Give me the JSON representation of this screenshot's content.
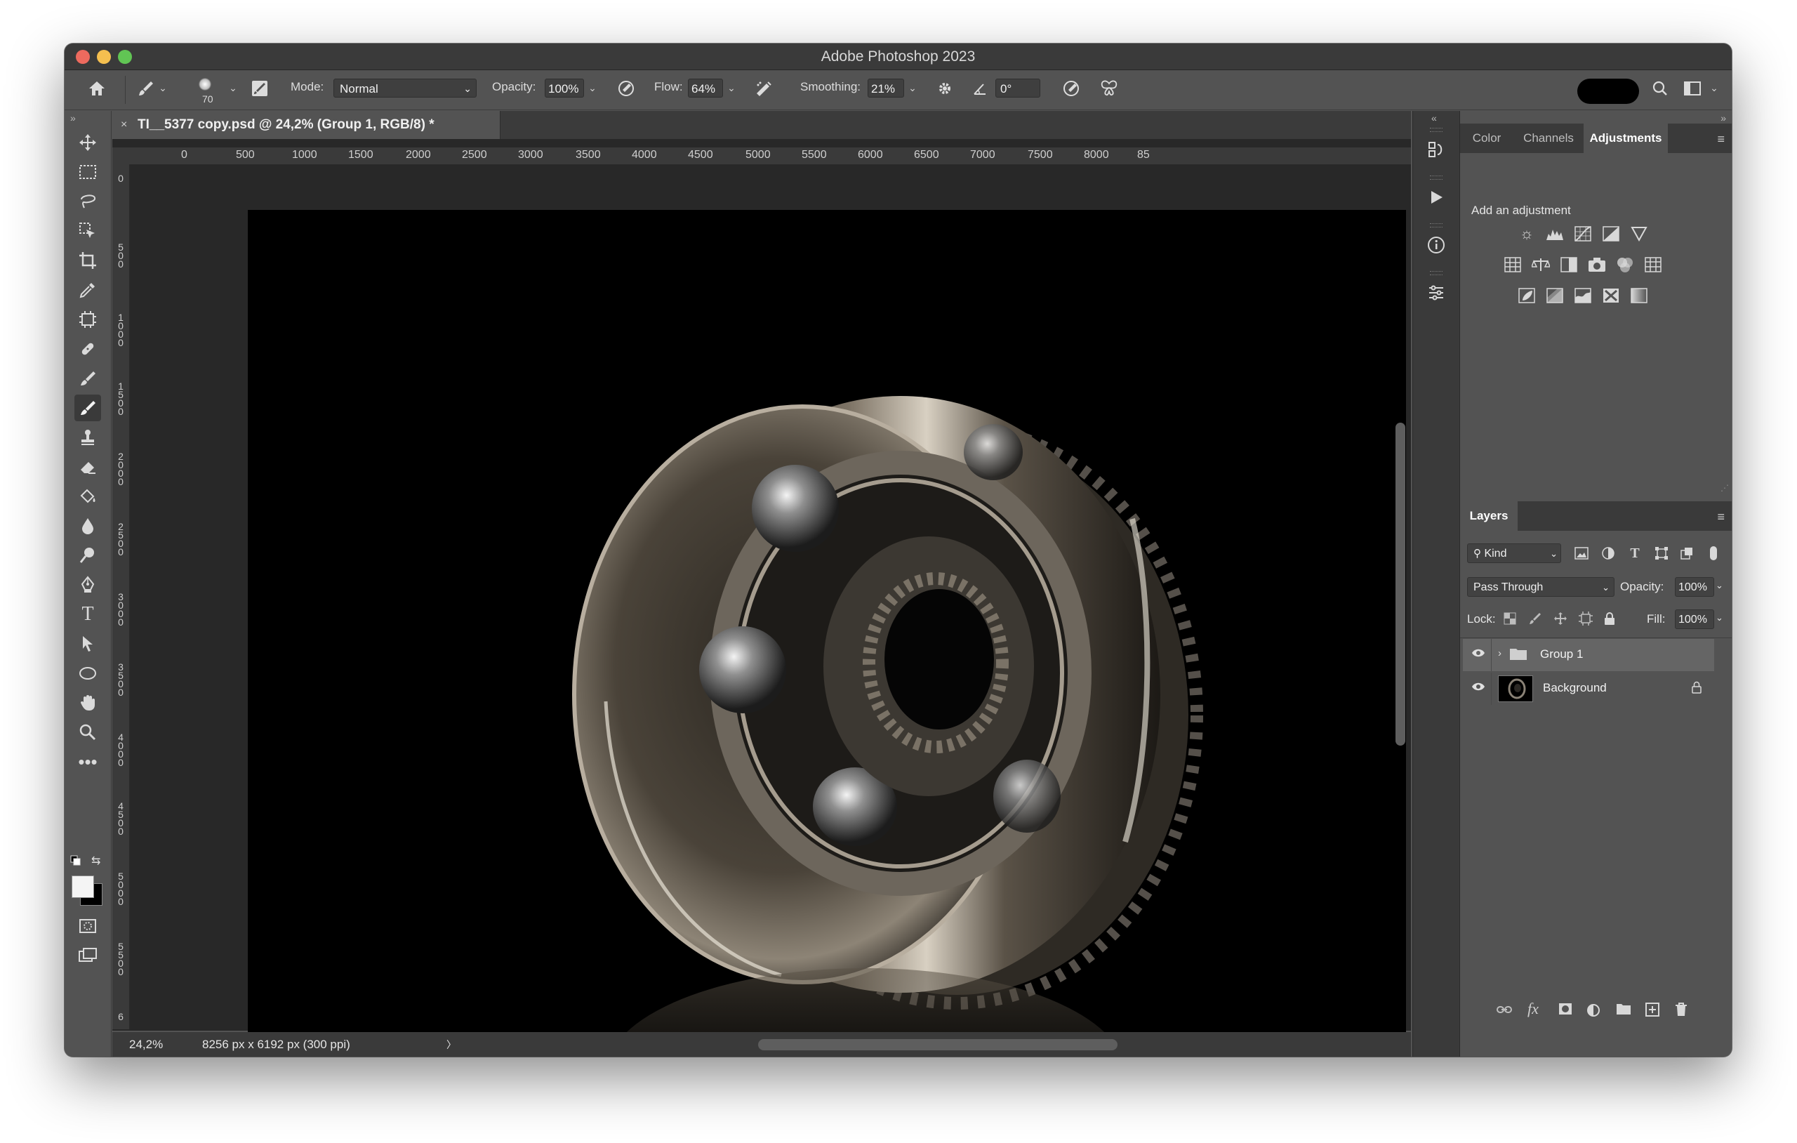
{
  "window": {
    "title": "Adobe Photoshop 2023"
  },
  "options_bar": {
    "brush_size": "70",
    "mode_label": "Mode:",
    "mode_value": "Normal",
    "opacity_label": "Opacity:",
    "opacity_value": "100%",
    "flow_label": "Flow:",
    "flow_value": "64%",
    "smoothing_label": "Smoothing:",
    "smoothing_value": "21%",
    "angle_value": "0°"
  },
  "document": {
    "tab_title": "TI__5377 copy.psd @ 24,2% (Group 1, RGB/8) *",
    "close": "×"
  },
  "ruler": {
    "top_ticks": [
      "0",
      "500",
      "1000",
      "1500",
      "2000",
      "2500",
      "3000",
      "3500",
      "4000",
      "4500",
      "5000",
      "5500",
      "6000",
      "6500",
      "7000",
      "7500",
      "8000",
      "85"
    ],
    "left_ticks": [
      "0",
      "500",
      "1000",
      "1500",
      "2000",
      "2500",
      "3000",
      "3500",
      "4000",
      "4500",
      "5000",
      "5500",
      "6"
    ]
  },
  "statusbar": {
    "zoom": "24,2%",
    "dimensions": "8256 px x 6192 px (300 ppi)",
    "arrow": "〉"
  },
  "panels": {
    "top_tabs": [
      "Color",
      "Channels",
      "Adjustments"
    ],
    "active_top_tab": "Adjustments",
    "adjustments_hint": "Add an adjustment",
    "layers_tab": "Layers",
    "filter_kind": "Kind",
    "blend_mode": "Pass Through",
    "opacity_label": "Opacity:",
    "opacity_value": "100%",
    "lock_label": "Lock:",
    "fill_label": "Fill:",
    "fill_value": "100%",
    "layers": [
      {
        "name": "Group 1",
        "type": "group",
        "visible": true,
        "selected": true
      },
      {
        "name": "Background",
        "type": "pixel",
        "visible": true,
        "locked": true
      }
    ]
  },
  "colors": {
    "ui_dark": "#3a3a3a",
    "ui_mid": "#535353",
    "canvas_bg": "#282828",
    "foreground": "#ffffff",
    "background": "#000000"
  }
}
